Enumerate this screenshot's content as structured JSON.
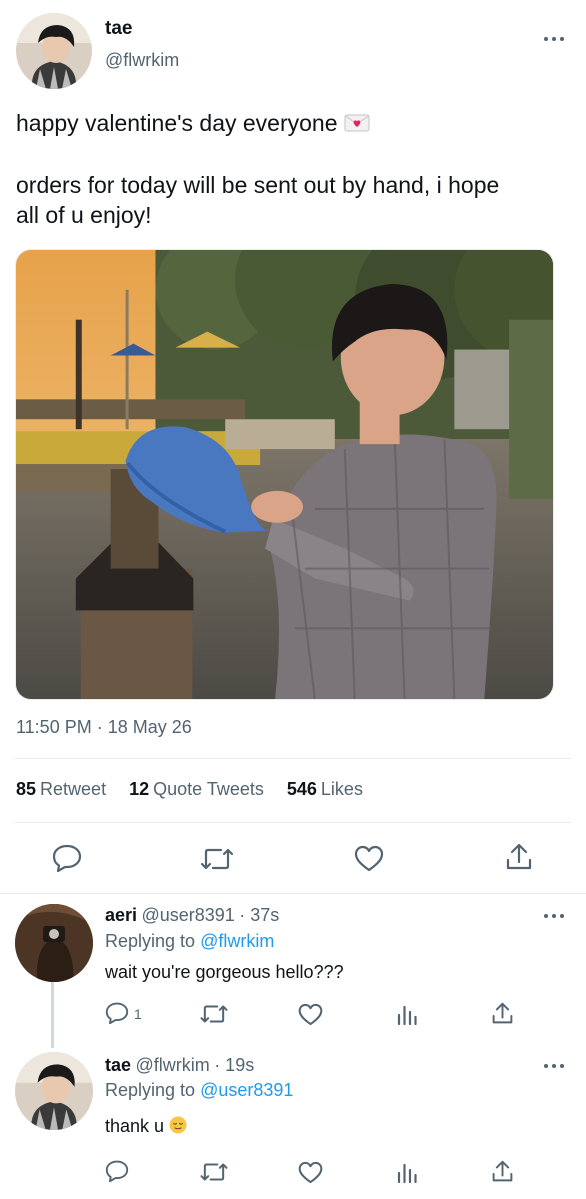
{
  "main_tweet": {
    "author_name": "tae",
    "author_handle": "@flwrkim",
    "text_line_1": "happy valentine's day everyone",
    "text_line_2": "orders for today will be sent out by hand, i hope",
    "text_line_3": "all of u enjoy!",
    "emoji": "love-letter-icon",
    "timestamp": "11:50 PM · 18 May 26",
    "stats": {
      "retweets_count": "85",
      "retweets_label": "Retweet",
      "quotes_count": "12",
      "quotes_label": "Quote Tweets",
      "likes_count": "546",
      "likes_label": "Likes"
    }
  },
  "replies": [
    {
      "author_name": "aeri",
      "author_handle": "@user8391",
      "time": "· 37s",
      "replying_prefix": "Replying to",
      "replying_to": "@flwrkim",
      "text": "wait you're gorgeous hello???",
      "reply_count": "1"
    },
    {
      "author_name": "tae",
      "author_handle": "@flwrkim",
      "time": "· 19s",
      "replying_prefix": "Replying to",
      "replying_to": "@user8391",
      "text": "thank u",
      "emoji": "relieved-face-icon"
    }
  ],
  "colors": {
    "text": "#0f1419",
    "secondary": "#536471",
    "link": "#1d9bf0",
    "divider": "#e6ecf0"
  }
}
